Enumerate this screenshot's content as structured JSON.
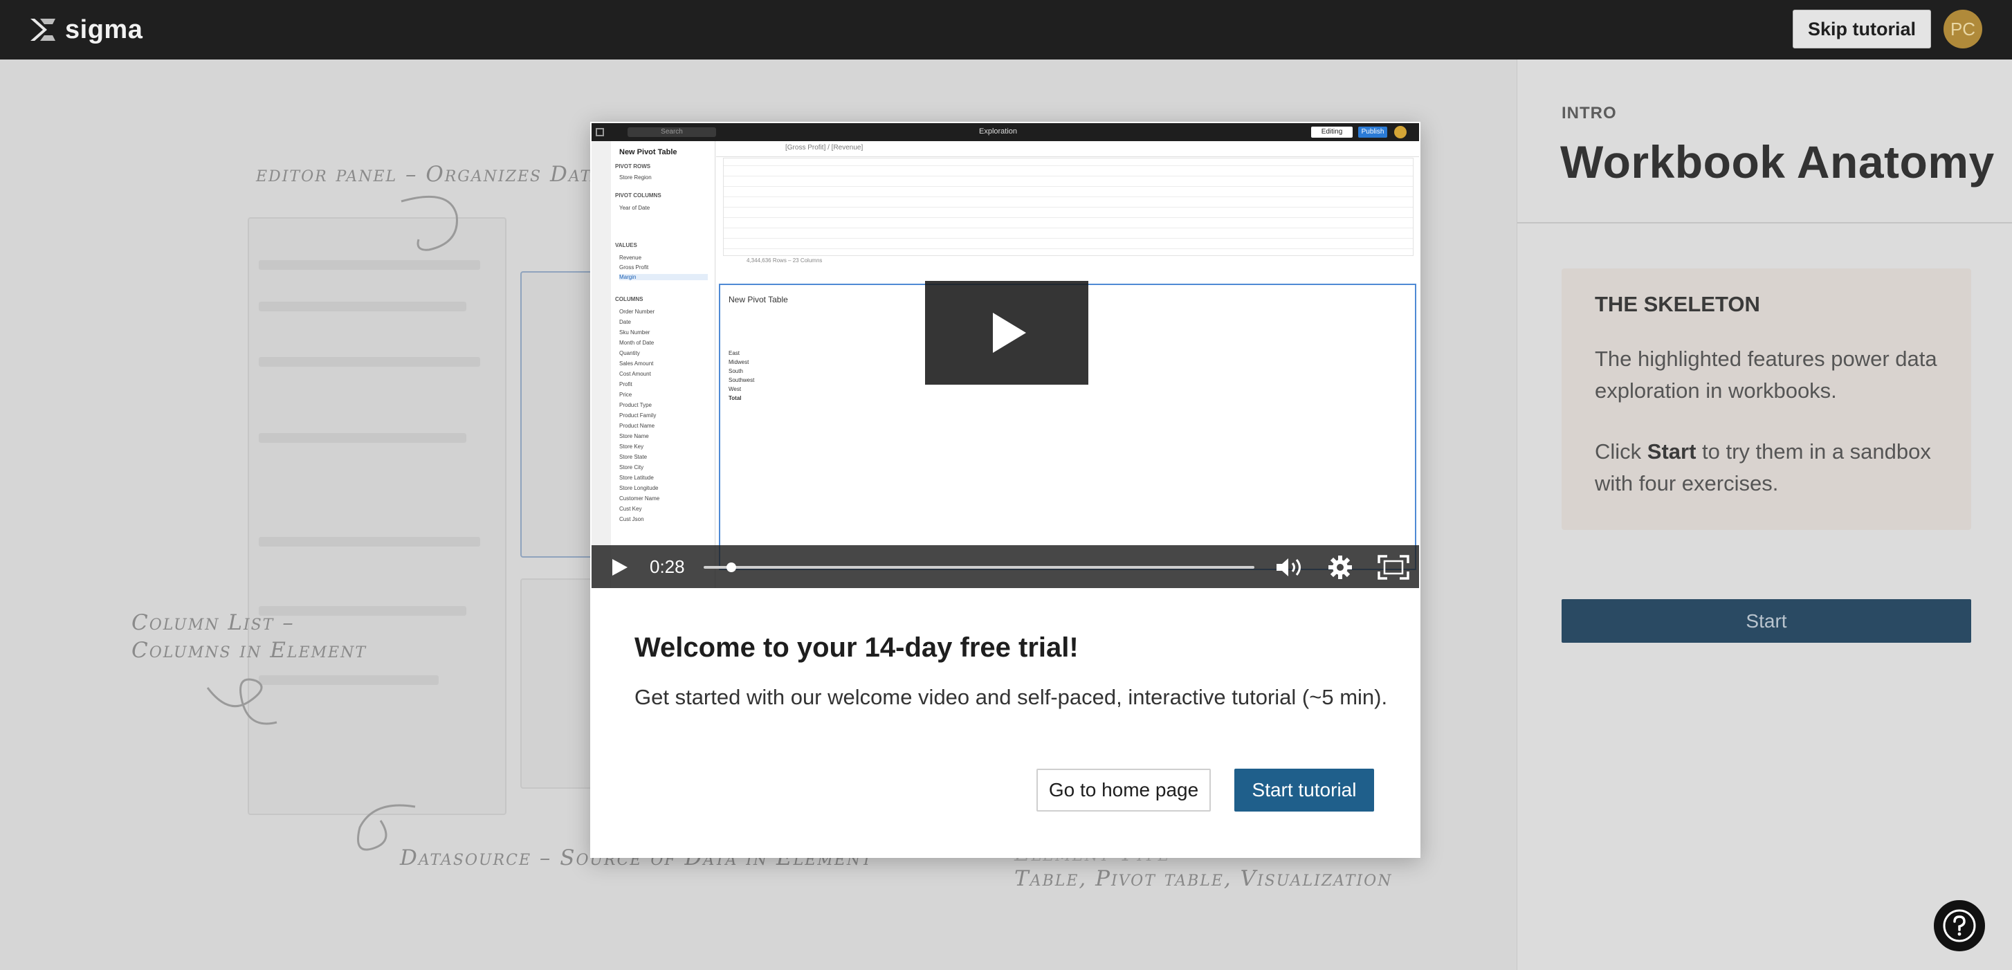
{
  "app": {
    "logo_text": "sigma"
  },
  "header": {
    "skip_label": "Skip tutorial",
    "avatar_initials": "PC"
  },
  "background": {
    "annotations": {
      "editor_panel": "editor panel – Organizes Data",
      "column_list_1": "Column List –",
      "column_list_2": "Columns in Element",
      "datasource": "Datasource – Source of Data in Element",
      "element_type_1": "Element Type",
      "element_type_2": "Table, Pivot table, Visualization"
    }
  },
  "right_panel": {
    "intro_label": "INTRO",
    "title": "Workbook Anatomy",
    "skeleton_title": "THE SKELETON",
    "skeleton_text": "The highlighted features power data exploration in workbooks.",
    "skeleton_text2_pre": "Click ",
    "skeleton_text2_bold": "Start",
    "skeleton_text2_post": " to try them in a sandbox with four exercises.",
    "start_label": "Start"
  },
  "modal": {
    "heading": "Welcome to your 14-day free trial!",
    "subtext": "Get started with our welcome video and self-paced, interactive tutorial (~5 min).",
    "home_label": "Go to home page",
    "start_label": "Start tutorial",
    "video": {
      "time": "0:28",
      "progress": 0.05,
      "frame": {
        "search_placeholder": "Search",
        "center_title": "Exploration",
        "editing_label": "Editing",
        "publish_label": "Publish",
        "formula": "[Gross Profit] / [Revenue]",
        "element_title": "New Pivot Table",
        "sections": {
          "pivot_rows": "PIVOT ROWS",
          "pivot_columns": "PIVOT COLUMNS",
          "values": "VALUES",
          "columns": "COLUMNS"
        },
        "pivot_row_items": [
          "Store Region"
        ],
        "pivot_column_items": [
          "Year of Date"
        ],
        "value_items": [
          "Revenue",
          "Gross Profit",
          "Margin"
        ],
        "column_items": [
          "Order Number",
          "Date",
          "Sku Number",
          "Month of Date",
          "Quantity",
          "Sales Amount",
          "Cost Amount",
          "Profit",
          "Price",
          "Product Type",
          "Product Family",
          "Product Name",
          "Store Name",
          "Store Key",
          "Store State",
          "Store City",
          "Store Latitude",
          "Store Longitude",
          "Customer Name",
          "Cust Key",
          "Cust Json"
        ],
        "summary_text": "4,344,636 Rows – 23 Columns",
        "pivot_title": "New Pivot Table",
        "pivot_regions": [
          "East",
          "Midwest",
          "South",
          "Southwest",
          "West",
          "Total"
        ]
      }
    }
  }
}
